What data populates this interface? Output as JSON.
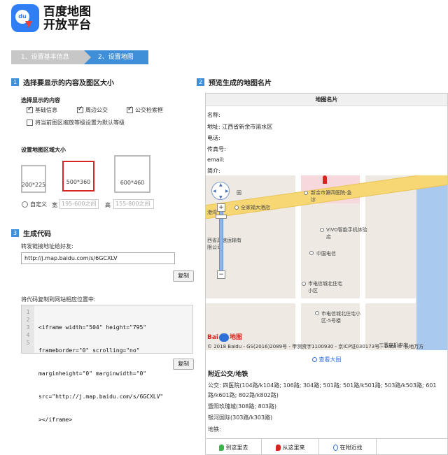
{
  "header": {
    "logo_text_line1": "百度地图",
    "logo_text_line2": "开放平台",
    "logo_icon_text": "du"
  },
  "steps": [
    {
      "label": "1、设置基本信息",
      "active": false
    },
    {
      "label": "2、设置地图",
      "active": true
    }
  ],
  "section1": {
    "num": "1",
    "title": "选择要显示的内容及图区大小",
    "content_label": "选择显示的内容",
    "checkboxes": [
      {
        "label": "基础信息",
        "checked": true
      },
      {
        "label": "周边公交",
        "checked": true
      },
      {
        "label": "公交检索框",
        "checked": true
      },
      {
        "label": "将当前图区缩放等级设置为默认等级",
        "checked": false
      }
    ],
    "size_label": "设置地图区域大小",
    "sizes": [
      "200*225",
      "500*360",
      "600*460"
    ],
    "selected_size": "500*360",
    "custom_label": "自定义",
    "width_label": "宽",
    "width_placeholder": "195-600之间",
    "height_label": "高",
    "height_placeholder": "155-800之间"
  },
  "section3": {
    "num": "3",
    "title": "生成代码",
    "share_label": "转发链接地址给好友:",
    "share_url": "http://j.map.baidu.com/s/6GCXLV",
    "copy_label": "复制",
    "code_label": "将代码复制到网站相应位置中:",
    "code_line_numbers": [
      "1",
      "2",
      "3",
      "4",
      "5"
    ],
    "code_lines": [
      "<iframe width=\"504\" height=\"795\"",
      "frameborder=\"0\" scrolling=\"no\"",
      "marginheight=\"0\" marginwidth=\"0\"",
      "src=\"http://j.map.baidu.com/s/6GCXLV\"",
      "></iframe>"
    ],
    "copy_label2": "复制"
  },
  "section2": {
    "num": "2",
    "title": "预览生成的地图名片"
  },
  "card": {
    "title": "地图名片",
    "name_label": "名称:",
    "address_label": "地址: 江西省新余市渝水区",
    "phone_label": "电话:",
    "fax_label": "传真号:",
    "email_label": "email:",
    "intro_label": "简介:",
    "map_pois": {
      "p1": "新余市第四医院-急诊",
      "p2": "全家福大酒店",
      "p3": "ViVO智能手机体验店",
      "p4": "中国电信",
      "p5": "市电信城北住宅小区",
      "p6": "市电信城北住宅小区-5号楼",
      "p7": "西省高速运输有限公司",
      "p8": "三季电机中店",
      "p9": "港湾",
      "p10": "园"
    },
    "baidu_logo_text1": "Bai",
    "baidu_logo_text2": "地图",
    "copyright": "© 2018 Baidu - GS(2016)2089号 - 甲测资字1100930 - 京ICP证030173号 - Data © 长地万方",
    "view_big": "查看大图",
    "nearby_title": "附近公交/地铁",
    "bus_lines": [
      "公交:  四医院(104路/k104路; 106路; 304路; 501路; 501路/k501路; 503路/k503路; 601",
      "路/k601路; 802路/k802路)",
      "暨阳玖瑰城(308路; 803路)",
      "银河国际(303路/k303路)",
      "地铁:"
    ],
    "tabs": [
      "到这里去",
      "从这里来",
      "在附近找"
    ]
  },
  "colors": {
    "accent": "#3f8fd8",
    "selected_border": "#d6261f",
    "link": "#2f6fd8"
  }
}
